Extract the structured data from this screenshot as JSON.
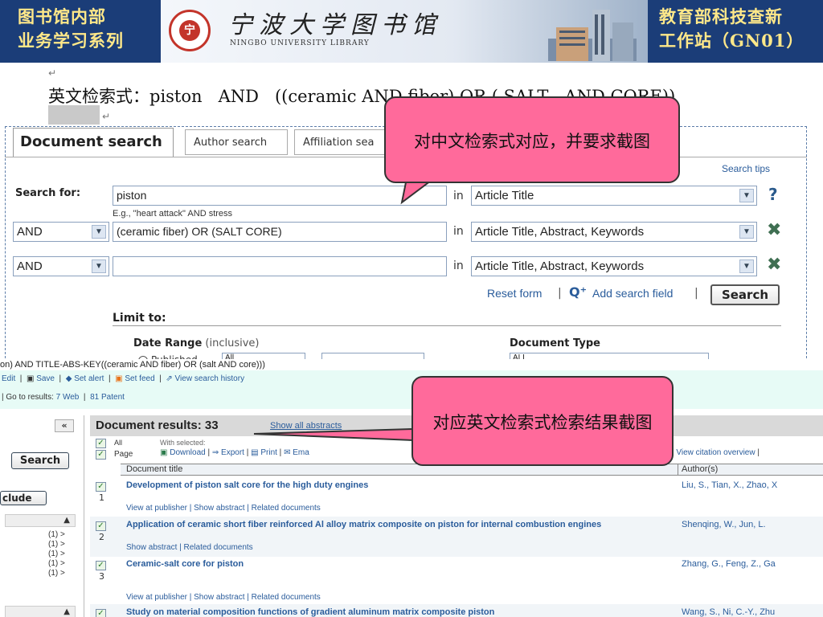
{
  "banner": {
    "left_line1": "图书馆内部",
    "left_line2": "业务学习系列",
    "logo_char": "宁",
    "library_cn": "宁波大学图书馆",
    "library_en": "NINGBO UNIVERSITY LIBRARY",
    "right_line1": "教育部科技查新",
    "right_line2": "工作站（GN01）"
  },
  "query": {
    "label": "英文检索式：",
    "expr": "piston   AND   ((ceramic AND fiber) OR ( SALT   AND CORE))",
    "return_mark": "↵"
  },
  "tabs": {
    "active": "Document search",
    "author": "Author search",
    "affiliation": "Affiliation sea"
  },
  "search_form": {
    "search_tips": "Search tips",
    "search_for": "Search for:",
    "row1_value": "piston",
    "row1_hint": "E.g., \"heart attack\" AND stress",
    "row1_field": "Article Title",
    "row2_op": "AND",
    "row2_value": "(ceramic fiber) OR (SALT CORE)",
    "row2_field": "Article Title, Abstract, Keywords",
    "row3_op": "AND",
    "row3_value": "",
    "row3_field": "Article Title, Abstract, Keywords",
    "in_label": "in",
    "reset_form": "Reset form",
    "add_field": "Add search field",
    "search_button": "Search",
    "limit_to": "Limit to:",
    "date_range": "Date Range",
    "inclusive": "(inclusive)",
    "published": "Published",
    "all": "All",
    "document_type": "Document Type",
    "doc_type_value": "ALL"
  },
  "results_bar": {
    "query_echo": "on) AND TITLE-ABS-KEY((ceramic AND fiber) OR (salt AND core)))",
    "edit": "Edit",
    "save": "Save",
    "set_alert": "Set alert",
    "set_feed": "Set feed",
    "view_history": "View search history",
    "go_to_results": "Go to results:",
    "web_count": "7",
    "web_label": "Web",
    "patent_count": "81",
    "patent_label": "Patent"
  },
  "left_panel": {
    "collapse": "«",
    "search_button": "Search",
    "exclude": "clude",
    "facet_counts": [
      "(1) >",
      "(1) >",
      "(1) >",
      "(1) >",
      "(1) >"
    ]
  },
  "results": {
    "heading": "Document results: 33",
    "show_all_abstracts": "Show all abstracts",
    "all_label": "All",
    "page_label": "Page",
    "with_selected": "With selected:",
    "download": "Download",
    "export": "Export",
    "print": "Print",
    "email": "Ema",
    "view_citation": "View citation overview",
    "col_title": "Document title",
    "col_authors": "Author(s)",
    "rows": [
      {
        "num": "1",
        "title": "Development of piston salt core for the high duty engines",
        "authors": "Liu, S., Tian, X., Zhao, X",
        "links": "View at publisher  |  Show abstract  |  Related documents"
      },
      {
        "num": "2",
        "title": "Application of ceramic short fiber reinforced Al alloy matrix composite on piston for internal combustion engines",
        "authors": "Shenqing, W., Jun, L.",
        "links": "Show abstract  |  Related documents"
      },
      {
        "num": "3",
        "title": "Ceramic-salt core for piston",
        "authors": "Zhang, G., Feng, Z., Ga",
        "links": "View at publisher  |  Show abstract  |  Related documents"
      },
      {
        "num": "4",
        "title": "Study on material composition functions of gradient aluminum matrix composite piston",
        "authors": "Wang, S., Ni, C.-Y., Zhu",
        "links": ""
      }
    ]
  },
  "callouts": {
    "top": "对中文检索式对应，并要求截图",
    "bottom": "对应英文检索式检索结果截图"
  },
  "colors": {
    "banner_bg": "#1b3d78",
    "banner_text": "#ffe889",
    "callout": "#ff6a9b",
    "link": "#2a5c9b"
  }
}
